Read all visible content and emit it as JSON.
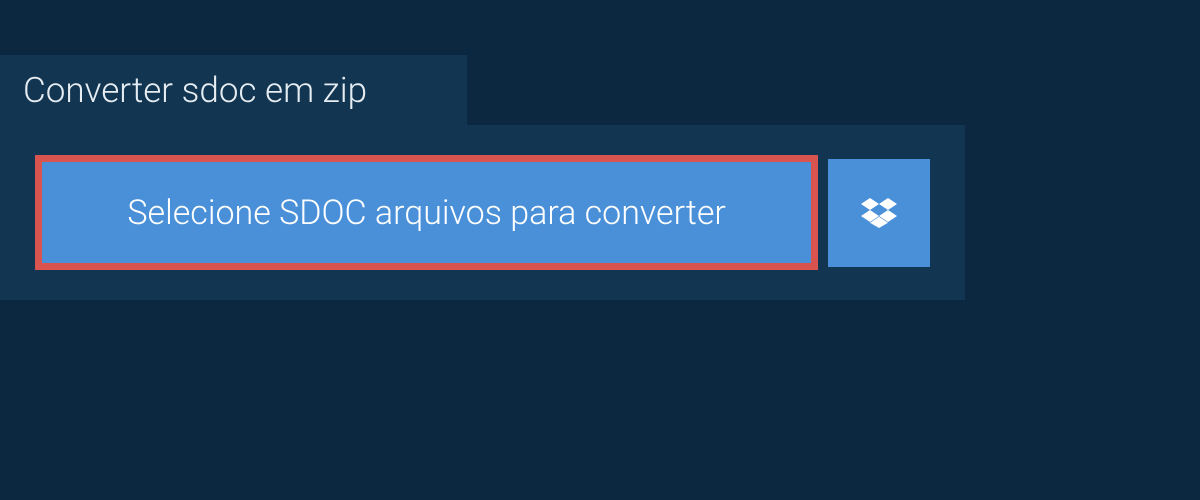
{
  "header": {
    "title": "Converter sdoc em zip"
  },
  "actions": {
    "select_files_label": "Selecione SDOC arquivos para converter",
    "dropbox_label": "Dropbox"
  },
  "colors": {
    "background": "#0c2841",
    "panel": "#123551",
    "button": "#4a90d9",
    "highlight_border": "#d9534f",
    "text_light": "#e6edf2",
    "text_white": "#ffffff"
  }
}
